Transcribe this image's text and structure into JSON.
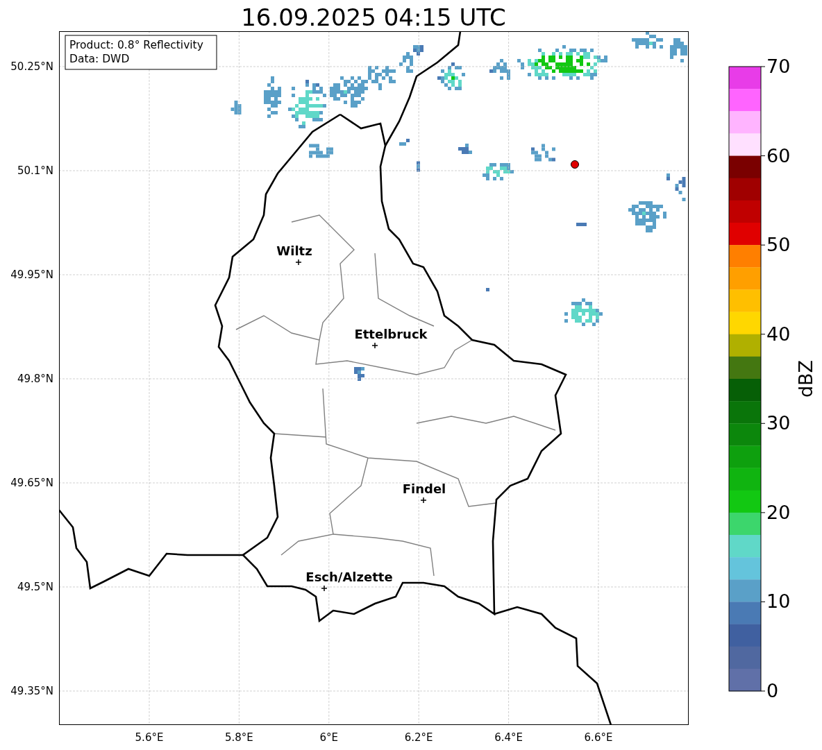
{
  "title": "16.09.2025 04:15 UTC",
  "info_box": [
    "Product: 0.8° Reflectivity",
    "Data: DWD"
  ],
  "map": {
    "lat_ticks": [
      "50.25°N",
      "50.1°N",
      "49.95°N",
      "49.8°N",
      "49.65°N",
      "49.5°N",
      "49.35°N"
    ],
    "lon_ticks": [
      "5.6°E",
      "5.8°E",
      "6°E",
      "6.2°E",
      "6.4°E",
      "6.6°E"
    ],
    "cities": [
      "Wiltz",
      "Ettelbruck",
      "Findel",
      "Esch/Alzette"
    ]
  },
  "colorbar": {
    "label": "dBZ",
    "ticks": [
      "70",
      "60",
      "50",
      "40",
      "30",
      "20",
      "10",
      "0"
    ],
    "bins": [
      {
        "color": "#e83ce8"
      },
      {
        "color": "#ff64ff"
      },
      {
        "color": "#ffb4ff"
      },
      {
        "color": "#ffe0ff"
      },
      {
        "color": "#7a0000"
      },
      {
        "color": "#a00000"
      },
      {
        "color": "#c00000"
      },
      {
        "color": "#e00000"
      },
      {
        "color": "#ff7f00"
      },
      {
        "color": "#ff9f00"
      },
      {
        "color": "#ffbf00"
      },
      {
        "color": "#ffd700"
      },
      {
        "color": "#b0b000"
      },
      {
        "color": "#447711"
      },
      {
        "color": "#065f06"
      },
      {
        "color": "#0a750a"
      },
      {
        "color": "#0c870c"
      },
      {
        "color": "#0ea00e"
      },
      {
        "color": "#10b410"
      },
      {
        "color": "#12c812"
      },
      {
        "color": "#3cd66c"
      },
      {
        "color": "#60d8c8"
      },
      {
        "color": "#64c4dc"
      },
      {
        "color": "#5aa0c8"
      },
      {
        "color": "#4a7ab4"
      },
      {
        "color": "#4060a0"
      },
      {
        "color": "#5068a0"
      },
      {
        "color": "#6070a8"
      }
    ]
  }
}
